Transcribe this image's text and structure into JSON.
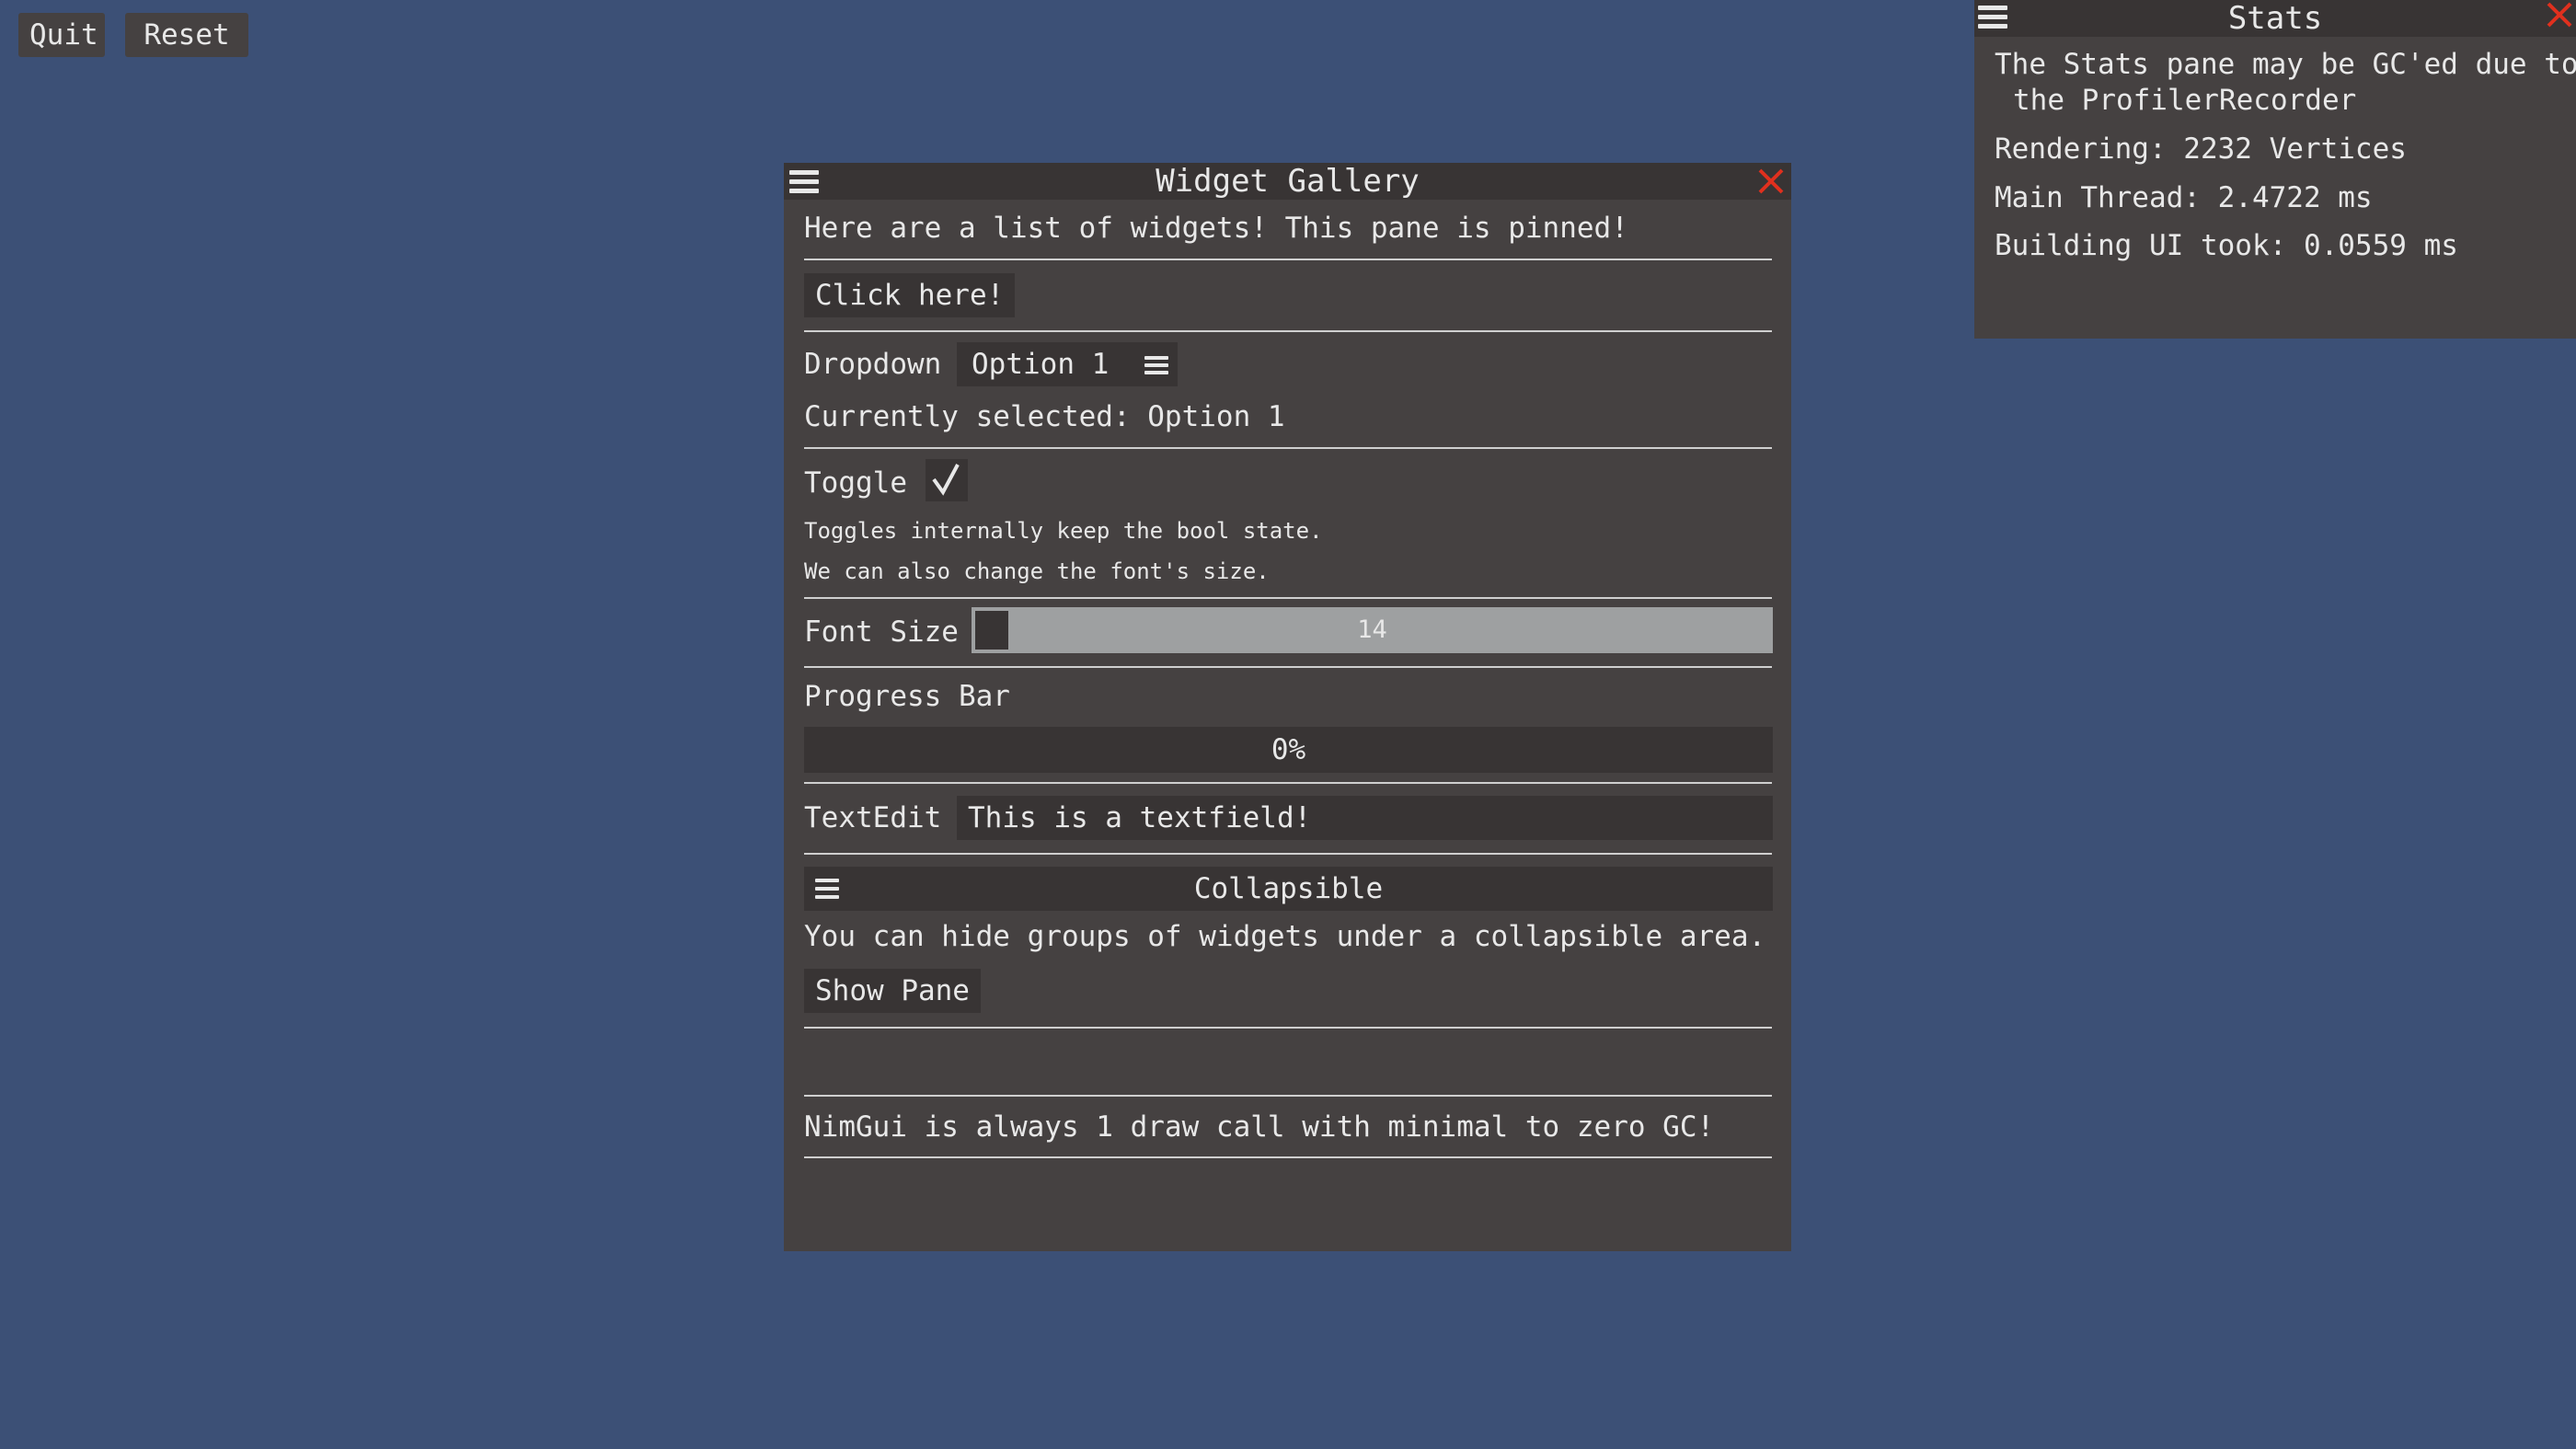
{
  "top_buttons": {
    "quit": "Quit",
    "reset": "Reset"
  },
  "gallery": {
    "title": "Widget Gallery",
    "intro": "Here are a list of widgets!  This pane is pinned!",
    "click_button": "Click here!",
    "dropdown_label": "Dropdown",
    "dropdown_value": "Option 1",
    "selected_text": "Currently selected: Option 1",
    "toggle_label": "Toggle",
    "toggle_checked": true,
    "toggle_note_1": "Toggles internally keep the bool state.",
    "toggle_note_2": "We can also change the font's size.",
    "font_size_label": "Font Size",
    "font_size_value": "14",
    "progress_label": "Progress Bar",
    "progress_text": "0%",
    "progress_fraction": 0,
    "textedit_label": "TextEdit",
    "textedit_value": "This is a textfield!",
    "collapsible_title": "Collapsible",
    "collapsible_text": "You can hide groups of widgets under a collapsible area.",
    "show_pane_button": "Show Pane",
    "footer_text": "NimGui is always 1 draw call with minimal to zero GC!"
  },
  "stats": {
    "title": "Stats",
    "gc_note_1": "The Stats pane may be GC'ed due to",
    "gc_note_2": "the ProfilerRecorder",
    "rendering": "Rendering: 2232 Vertices",
    "main_thread": "Main Thread: 2.4722 ms",
    "building_ui": "Building UI took: 0.0559 ms"
  },
  "colors": {
    "background": "#3c5076",
    "pane": "#454141",
    "pane_dark": "#383434",
    "close_red": "#e0301e",
    "slider_track": "#9ea0a1"
  },
  "icons": [
    "hamburger-menu-icon",
    "close-icon",
    "checkmark-icon"
  ]
}
